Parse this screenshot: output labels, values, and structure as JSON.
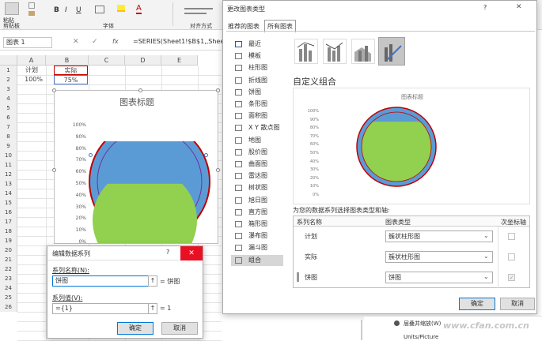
{
  "ribbon": {
    "paste_label": "粘贴",
    "clipboard_label": "剪贴板",
    "font_label": "字体",
    "align_label": "对齐方式",
    "bold": "B",
    "italic": "I",
    "underline": "U",
    "font_color_glyph": "A"
  },
  "formula_bar": {
    "name_box": "图表 1",
    "formula": "=SERIES(Sheet1!$B$1,,Sheet"
  },
  "sheet": {
    "columns": [
      "A",
      "B",
      "C",
      "D",
      "E"
    ],
    "rows": [
      "1",
      "2",
      "3",
      "4",
      "5",
      "6",
      "7",
      "8",
      "9",
      "10",
      "11",
      "12",
      "13",
      "14",
      "15",
      "16",
      "17",
      "18",
      "19",
      "20",
      "21",
      "22",
      "23",
      "24",
      "25",
      "26"
    ],
    "a1": "计划",
    "b1": "实际",
    "a2": "100%",
    "b2": "75%"
  },
  "chart": {
    "title": "图表标题",
    "y_ticks": [
      "100%",
      "90%",
      "80%",
      "70%",
      "60%",
      "50%",
      "40%",
      "30%",
      "20%",
      "10%",
      "0%"
    ]
  },
  "chart_data": {
    "type": "bar",
    "categories": [
      "计划",
      "实际"
    ],
    "values": [
      1.0,
      0.75
    ],
    "title": "图表标题",
    "ylim": [
      0,
      1
    ],
    "colors": {
      "outer": "#5b9bd5",
      "inner": "#92d050",
      "ring": "#c00000"
    }
  },
  "series_dialog": {
    "title": "编辑数据系列",
    "help": "?",
    "name_label": "系列名称(N):",
    "name_value": "饼图",
    "name_result": "= 饼图",
    "values_label": "系列值(V):",
    "values_value": "={1}",
    "values_result": "= 1",
    "ok": "确定",
    "cancel": "取消"
  },
  "chart_type_dialog": {
    "title": "更改图表类型",
    "help": "?",
    "tab_recommended": "推荐的图表",
    "tab_all": "所有图表",
    "types": [
      "最近",
      "模板",
      "柱形图",
      "折线图",
      "饼图",
      "条形图",
      "面积图",
      "X Y 散点图",
      "地图",
      "股价图",
      "曲面图",
      "雷达图",
      "树状图",
      "旭日图",
      "直方图",
      "箱形图",
      "瀑布图",
      "漏斗图",
      "组合"
    ],
    "selected_type": "组合",
    "heading": "自定义组合",
    "preview_title": "图表标题",
    "preview_ticks": [
      "100%",
      "90%",
      "80%",
      "70%",
      "60%",
      "50%",
      "40%",
      "30%",
      "20%",
      "10%",
      "0%"
    ],
    "prompt": "为您的数据系列选择图表类型和轴:",
    "col_name": "系列名称",
    "col_type": "图表类型",
    "col_axis": "次坐标轴",
    "series": [
      {
        "name": "计划",
        "type": "簇状柱形图"
      },
      {
        "name": "实际",
        "type": "簇状柱形图"
      },
      {
        "name": "饼图",
        "type": "饼图"
      }
    ],
    "ok": "确定",
    "cancel": "取消"
  },
  "sidepanel": {
    "option1": "层叠并缩放(W)",
    "option2": "Units/Picture"
  },
  "watermark": "www.cfan.com.cn"
}
